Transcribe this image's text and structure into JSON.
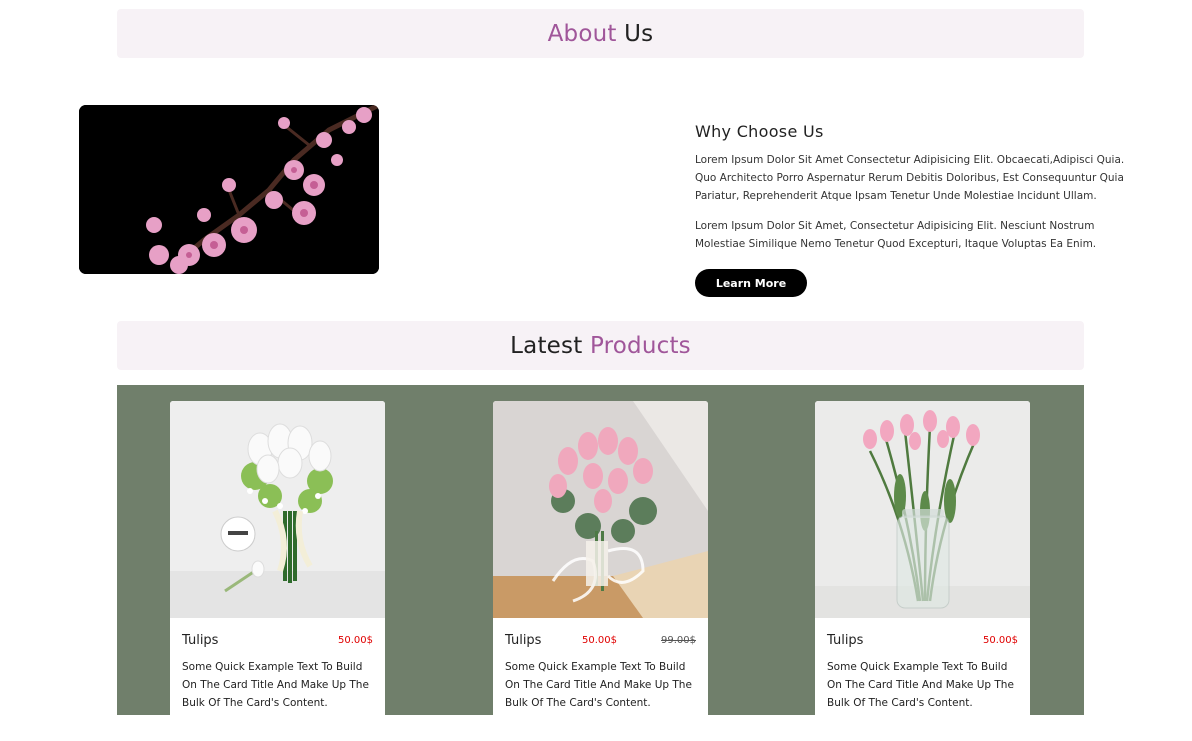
{
  "about_banner": {
    "accent": "About",
    "rest": " Us"
  },
  "why": {
    "title": "Why Choose Us",
    "p1": "Lorem Ipsum Dolor Sit Amet Consectetur Adipisicing Elit. Obcaecati,Adipisci Quia. Quo Architecto Porro Aspernatur Rerum Debitis Doloribus, Est Consequuntur Quia Pariatur, Reprehenderit Atque Ipsam Tenetur Unde Molestiae Incidunt Ullam.",
    "p2": "Lorem Ipsum Dolor Sit Amet, Consectetur Adipisicing Elit. Nesciunt Nostrum Molestiae Similique Nemo Tenetur Quod Excepturi, Itaque Voluptas Ea Enim.",
    "button": "Learn More"
  },
  "products_banner": {
    "lead": "Latest ",
    "accent": "Products"
  },
  "products": [
    {
      "title": "Tulips",
      "price": "50.00$",
      "old_price": "",
      "text": "Some Quick Example Text To Build On The Card Title And Make Up The Bulk Of The Card's Content."
    },
    {
      "title": "Tulips",
      "price": "50.00$",
      "old_price": "99.00$",
      "text": "Some Quick Example Text To Build On The Card Title And Make Up The Bulk Of The Card's Content."
    },
    {
      "title": "Tulips",
      "price": "50.00$",
      "old_price": "",
      "text": "Some Quick Example Text To Build On The Card Title And Make Up The Bulk Of The Card's Content."
    }
  ],
  "colors": {
    "accent": "#a0569a",
    "banner_bg": "#f7f2f6",
    "panel_bg": "#707f6b",
    "price": "#e00000"
  }
}
